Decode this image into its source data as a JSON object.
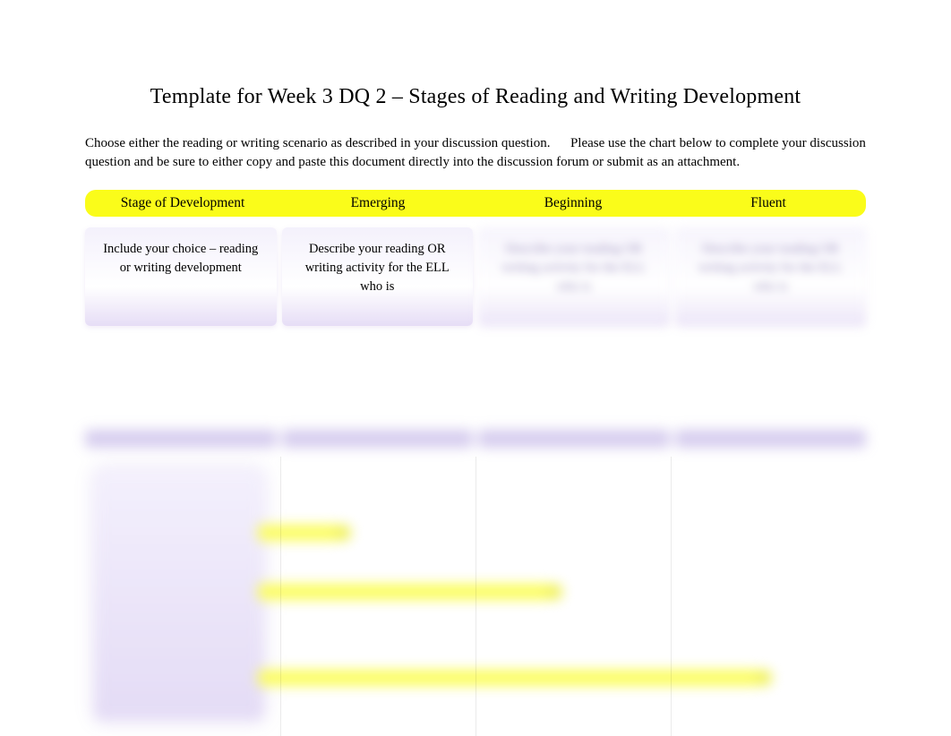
{
  "title": "Template for Week 3 DQ 2 – Stages of Reading and Writing Development",
  "intro": "Choose either the reading or writing scenario as described in your discussion question.      Please use the chart below to complete your discussion question and be sure to either copy and paste this document directly into the discussion forum or submit as an attachment.",
  "table": {
    "headers": [
      "Stage of Development",
      "Emerging",
      "Beginning",
      "Fluent"
    ],
    "row1": [
      "Include your choice – reading or writing development",
      "Describe your reading OR writing activity for the ELL who is",
      "Describe your reading OR writing activity for the ELL who is",
      "Describe your reading OR writing activity for the ELL who is"
    ]
  },
  "colors": {
    "highlight": "#fafc1a",
    "purple_light": "#efeafc",
    "purple_mid": "#c5b8e8"
  }
}
